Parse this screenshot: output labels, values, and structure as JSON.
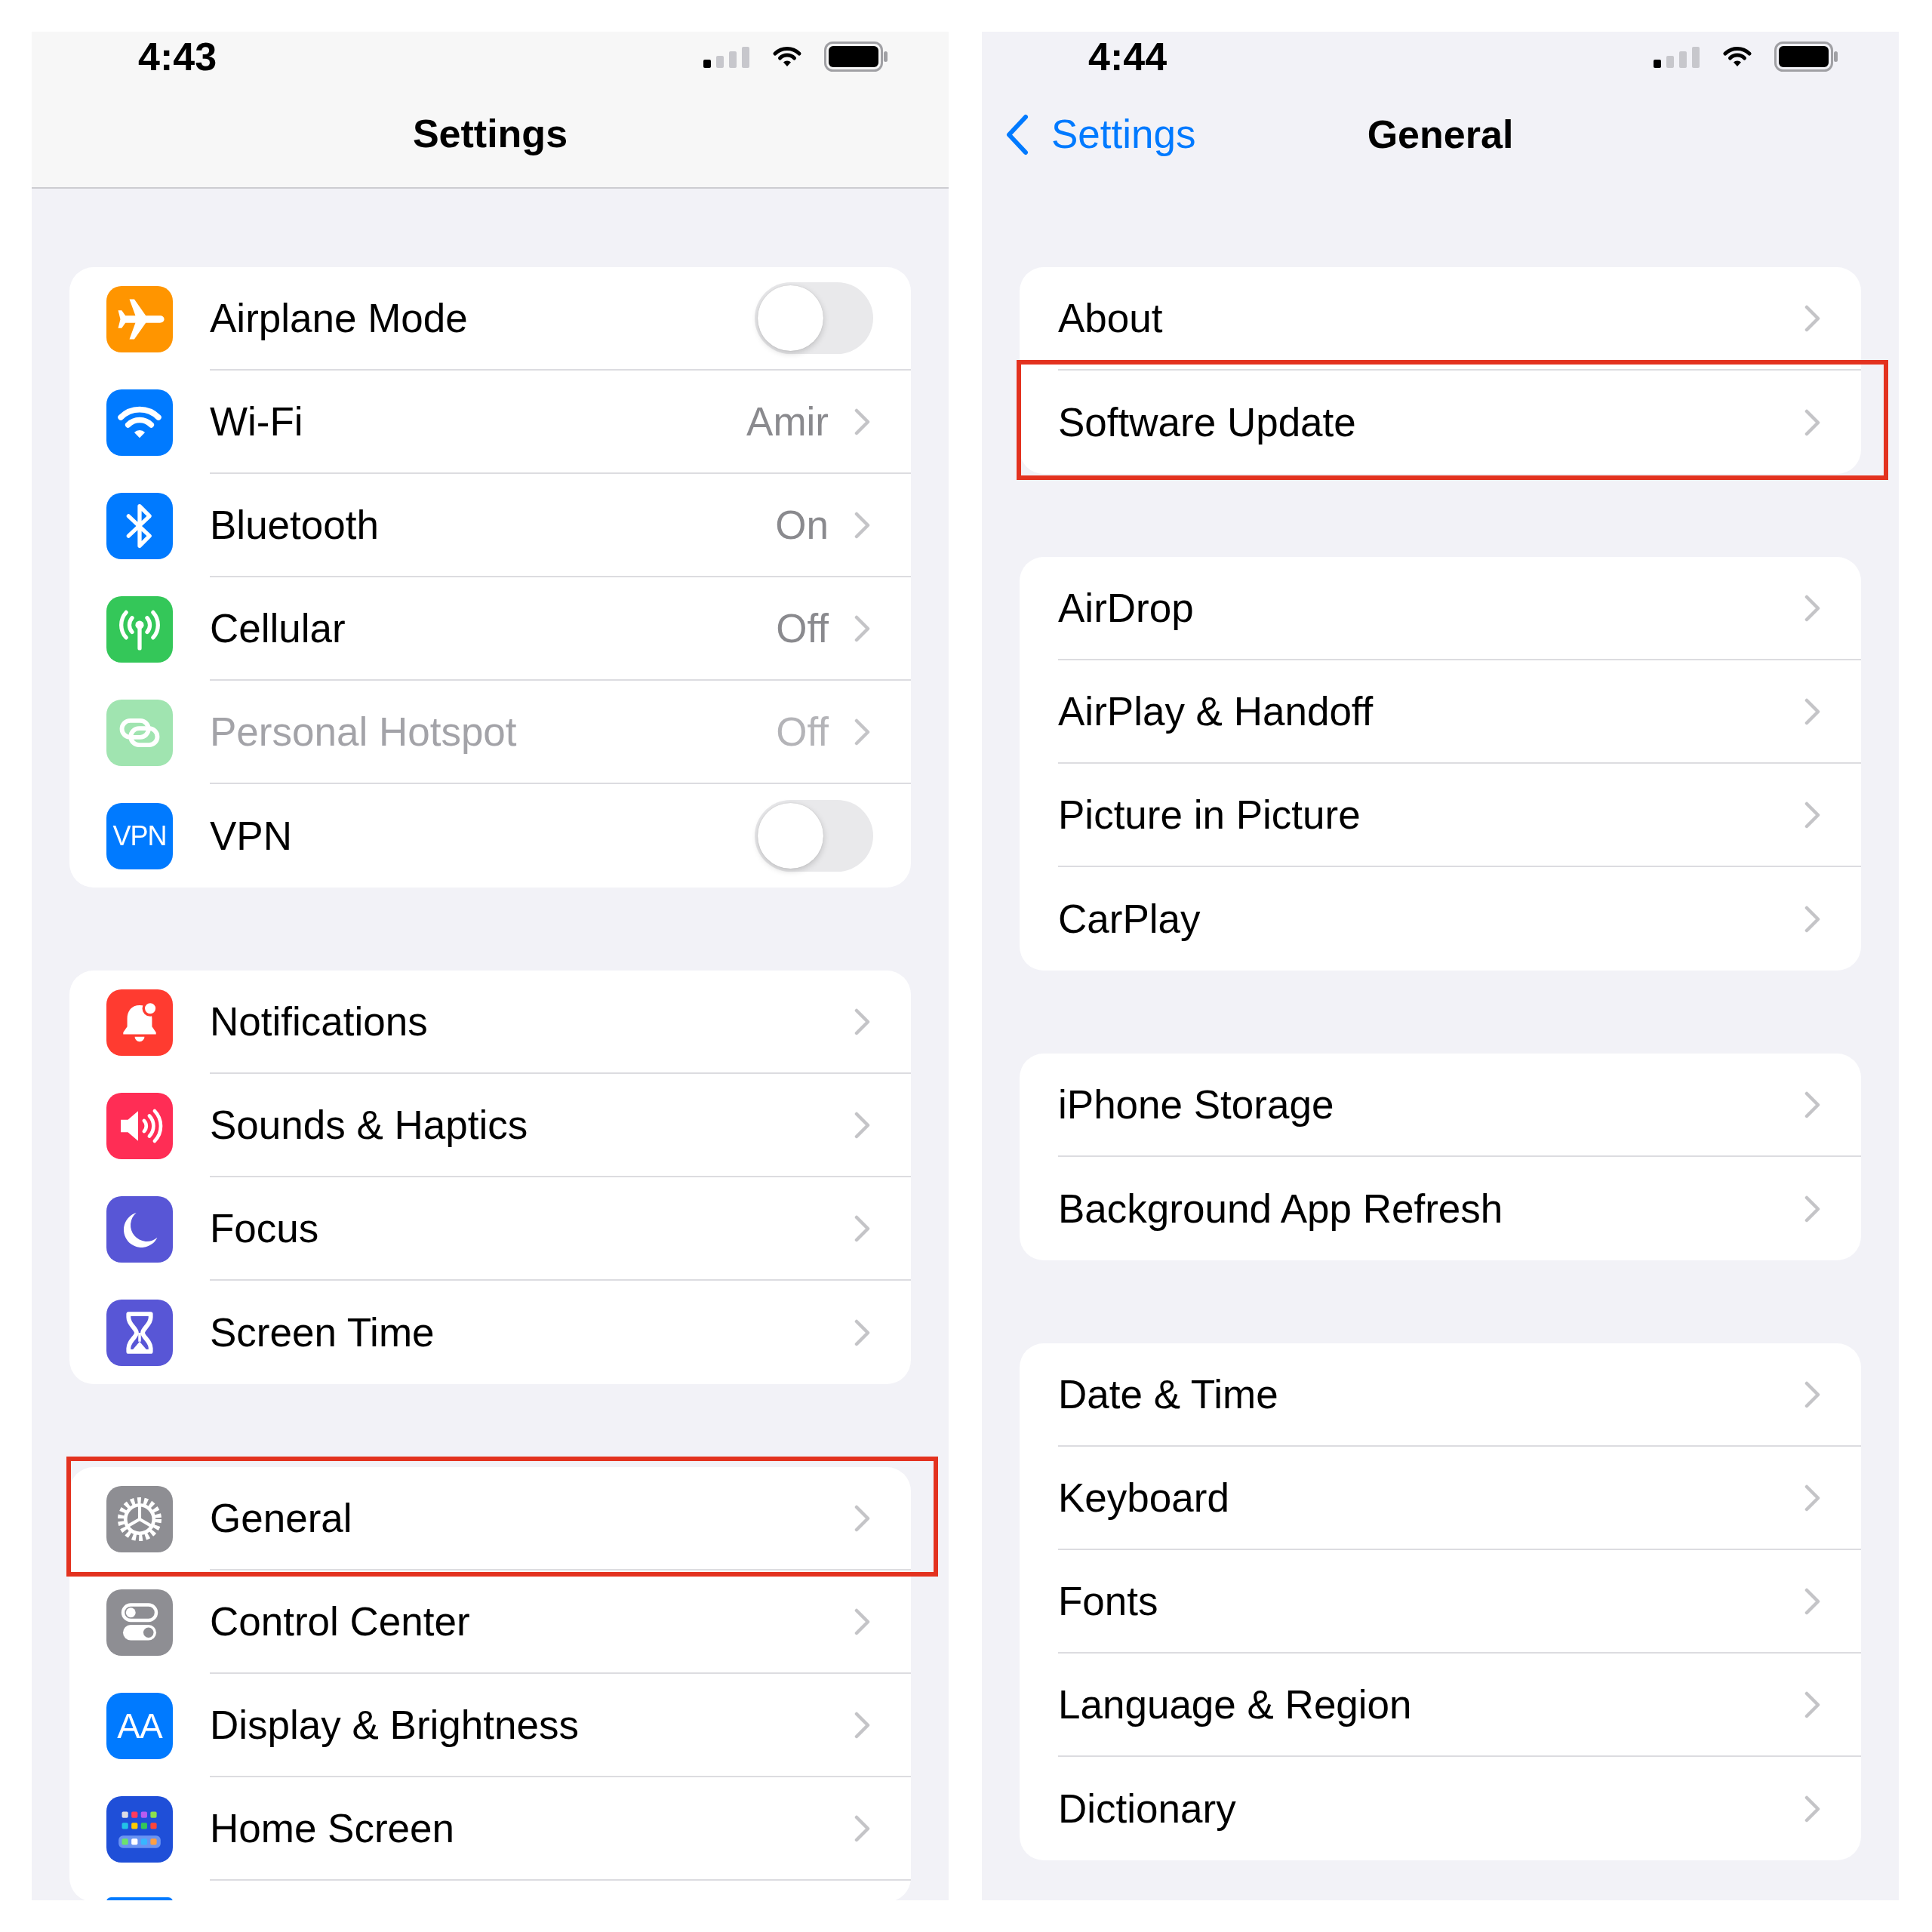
{
  "screens": [
    {
      "status_bar": {
        "time": "4:43"
      },
      "nav_bar": {
        "title": "Settings",
        "bordered": true
      },
      "groups": [
        {
          "items": [
            {
              "kind": "toggle",
              "icon": {
                "kind": "airplane",
                "color": "#ff9500"
              },
              "label": "Airplane Mode",
              "on": false,
              "disabled": false,
              "highlighted": false
            },
            {
              "kind": "link",
              "icon": {
                "kind": "wifi",
                "color": "#007aff"
              },
              "label": "Wi-Fi",
              "value": "Amir",
              "disabled": false,
              "highlighted": false
            },
            {
              "kind": "link",
              "icon": {
                "kind": "bluetooth",
                "color": "#007aff"
              },
              "label": "Bluetooth",
              "value": "On",
              "disabled": false,
              "highlighted": false
            },
            {
              "kind": "link",
              "icon": {
                "kind": "antenna",
                "color": "#34c759"
              },
              "label": "Cellular",
              "value": "Off",
              "disabled": false,
              "highlighted": false
            },
            {
              "kind": "link",
              "icon": {
                "kind": "chain_link",
                "color": "#a0e4b0"
              },
              "label": "Personal Hotspot",
              "value": "Off",
              "disabled": true,
              "highlighted": false
            },
            {
              "kind": "toggle",
              "icon": {
                "kind": "vpn",
                "color": "#007aff",
                "text": "VPN"
              },
              "label": "VPN",
              "on": false,
              "disabled": false,
              "highlighted": false
            }
          ]
        },
        {
          "items": [
            {
              "kind": "link",
              "icon": {
                "kind": "bell",
                "color": "#ff3b30"
              },
              "label": "Notifications",
              "highlighted": false
            },
            {
              "kind": "link",
              "icon": {
                "kind": "speaker",
                "color": "#ff2d55"
              },
              "label": "Sounds & Haptics",
              "highlighted": false
            },
            {
              "kind": "link",
              "icon": {
                "kind": "moon",
                "color": "#5856d6"
              },
              "label": "Focus",
              "highlighted": false
            },
            {
              "kind": "link",
              "icon": {
                "kind": "hourglass",
                "color": "#5856d6"
              },
              "label": "Screen Time",
              "highlighted": false
            }
          ]
        },
        {
          "items": [
            {
              "kind": "link",
              "icon": {
                "kind": "gear",
                "color": "#8e8e93"
              },
              "label": "General",
              "highlighted": true
            },
            {
              "kind": "link",
              "icon": {
                "kind": "switches",
                "color": "#8e8e93"
              },
              "label": "Control Center",
              "highlighted": false
            },
            {
              "kind": "link",
              "icon": {
                "kind": "text_size",
                "color": "#007aff",
                "text": "AA"
              },
              "label": "Display & Brightness",
              "highlighted": false
            },
            {
              "kind": "link",
              "icon": {
                "kind": "app_grid",
                "color": "#1f4fd8"
              },
              "label": "Home Screen",
              "highlighted": false
            },
            {
              "kind": "peek",
              "icon": {
                "kind": "partial",
                "color": "#007aff"
              },
              "highlighted": false
            }
          ]
        }
      ]
    },
    {
      "status_bar": {
        "time": "4:44"
      },
      "nav_bar": {
        "back_label": "Settings",
        "title": "General",
        "bordered": false
      },
      "groups": [
        {
          "items": [
            {
              "kind": "link",
              "label": "About",
              "highlighted": false
            },
            {
              "kind": "link",
              "label": "Software Update",
              "highlighted": true
            }
          ]
        },
        {
          "items": [
            {
              "kind": "link",
              "label": "AirDrop",
              "highlighted": false
            },
            {
              "kind": "link",
              "label": "AirPlay & Handoff",
              "highlighted": false
            },
            {
              "kind": "link",
              "label": "Picture in Picture",
              "highlighted": false
            },
            {
              "kind": "link",
              "label": "CarPlay",
              "highlighted": false
            }
          ]
        },
        {
          "items": [
            {
              "kind": "link",
              "label": "iPhone Storage",
              "highlighted": false
            },
            {
              "kind": "link",
              "label": "Background App Refresh",
              "highlighted": false
            }
          ]
        },
        {
          "items": [
            {
              "kind": "link",
              "label": "Date & Time",
              "highlighted": false
            },
            {
              "kind": "link",
              "label": "Keyboard",
              "highlighted": false
            },
            {
              "kind": "link",
              "label": "Fonts",
              "highlighted": false
            },
            {
              "kind": "link",
              "label": "Language & Region",
              "highlighted": false
            },
            {
              "kind": "link",
              "label": "Dictionary",
              "highlighted": false
            }
          ]
        }
      ]
    }
  ]
}
